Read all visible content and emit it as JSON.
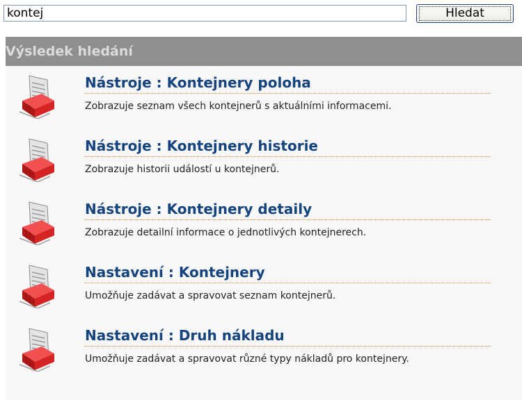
{
  "search": {
    "value": "kontej",
    "button_label": "Hledat"
  },
  "results": {
    "header": "Výsledek hledání",
    "items": [
      {
        "title": "Nástroje : Kontejnery poloha",
        "description": "Zobrazuje seznam všech kontejnerů s aktuálními informacemi."
      },
      {
        "title": "Nástroje : Kontejnery historie",
        "description": "Zobrazuje historii událostí u kontejnerů."
      },
      {
        "title": "Nástroje : Kontejnery detaily",
        "description": "Zobrazuje detailní informace o jednotlivých kontejnerech."
      },
      {
        "title": "Nastavení : Kontejnery",
        "description": "Umožňuje zadávat a spravovat seznam kontejnerů."
      },
      {
        "title": "Nastavení : Druh nákladu",
        "description": "Umožňuje zadávat a spravovat různé typy nákladů pro kontejnery."
      }
    ]
  },
  "icons": {
    "result": "document-container-icon"
  },
  "colors": {
    "header_bg": "#8f8f8f",
    "link": "#14437e",
    "underline": "#e58b3a",
    "container_red": "#d62424"
  }
}
